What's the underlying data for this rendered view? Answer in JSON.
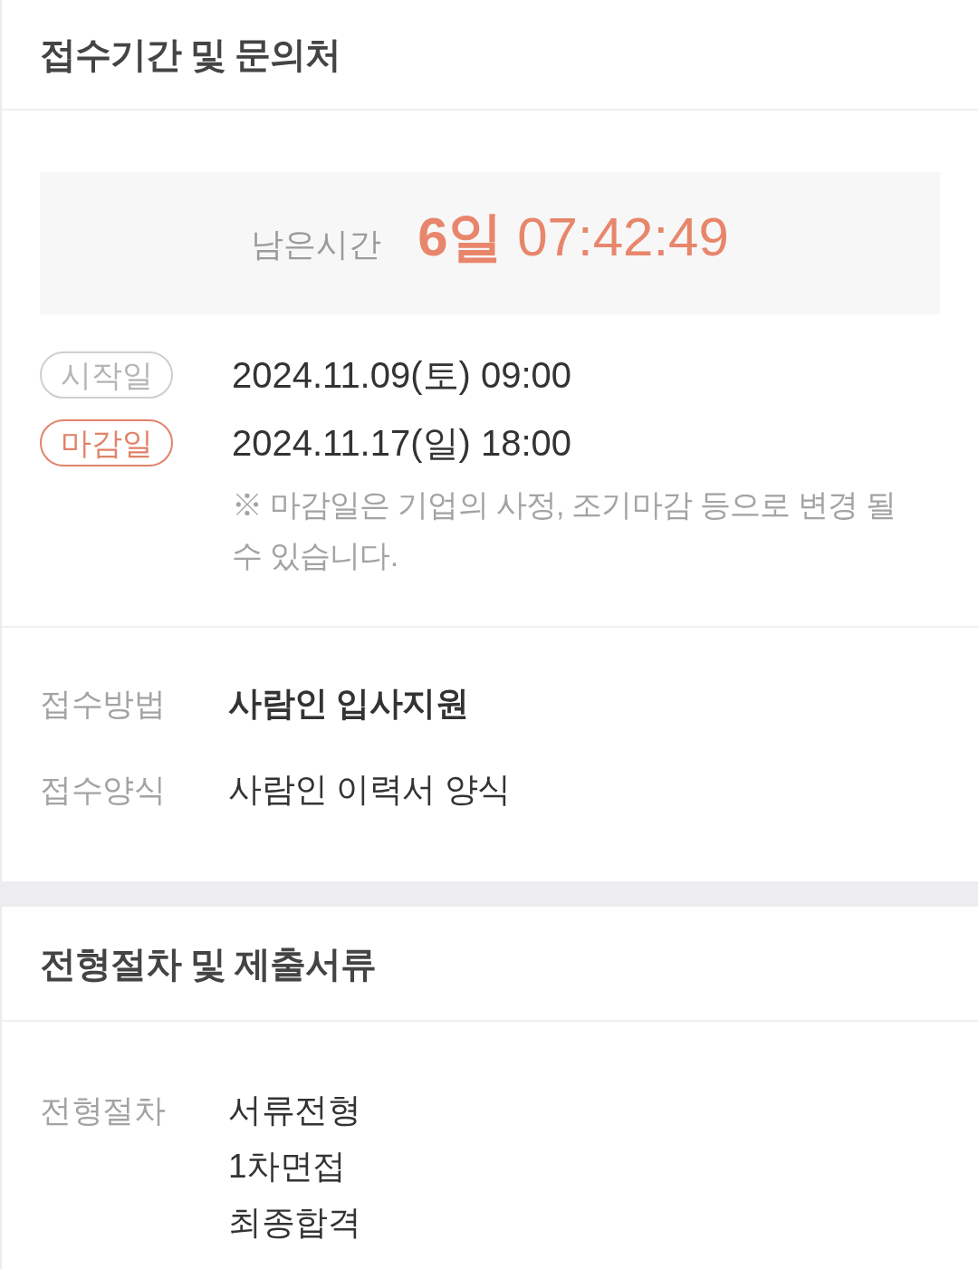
{
  "application": {
    "title": "접수기간 및 문의처",
    "countdown": {
      "label": "남은시간",
      "days": "6일",
      "time": "07:42:49"
    },
    "dates": [
      {
        "kind": "start",
        "badge": "시작일",
        "value": "2024.11.09(토) 09:00"
      },
      {
        "kind": "end",
        "badge": "마감일",
        "value": "2024.11.17(일) 18:00"
      }
    ],
    "note": "※ 마감일은 기업의 사정, 조기마감 등으로 변경 될 수 있습니다.",
    "fields": [
      {
        "kind": "bold",
        "label": "접수방법",
        "values": [
          "사람인 입사지원"
        ]
      },
      {
        "kind": "plain",
        "label": "접수양식",
        "values": [
          "사람인 이력서 양식"
        ]
      }
    ]
  },
  "process": {
    "title": "전형절차 및 제출서류",
    "fields": [
      {
        "kind": "plain",
        "label": "전형절차",
        "values": [
          "서류전형",
          "1차면접",
          "최종합격"
        ]
      }
    ]
  }
}
